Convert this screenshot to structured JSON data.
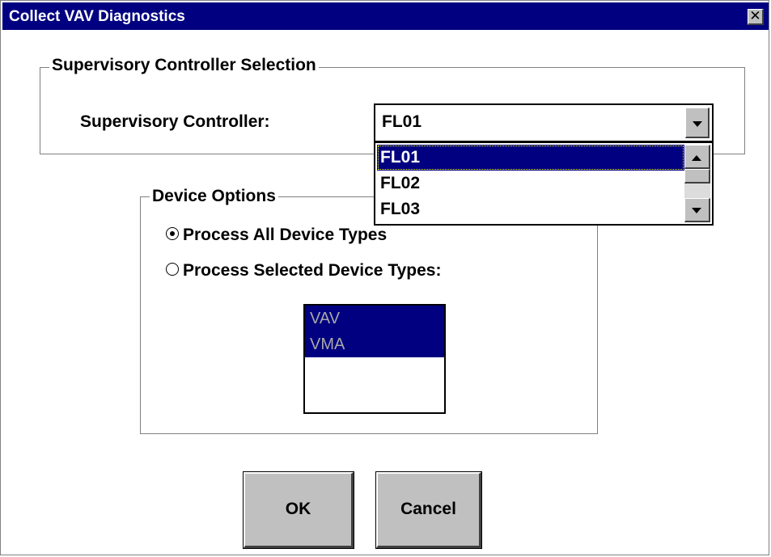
{
  "window": {
    "title": "Collect VAV Diagnostics",
    "close_glyph": "✕"
  },
  "supervisory_group": {
    "legend": "Supervisory Controller Selection",
    "label": "Supervisory Controller:",
    "selected_value": "FL01",
    "options": [
      "FL01",
      "FL02",
      "FL03"
    ]
  },
  "device_group": {
    "legend": "Device Options",
    "radio_all": "Process All Device Types",
    "radio_selected": "Process Selected Device Types:",
    "selected_radio": "all",
    "device_types": [
      "VAV",
      "VMA"
    ]
  },
  "buttons": {
    "ok": "OK",
    "cancel": "Cancel"
  },
  "colors": {
    "title_bar": "#000080",
    "selection": "#000080",
    "button_face": "#c0c0c0"
  }
}
